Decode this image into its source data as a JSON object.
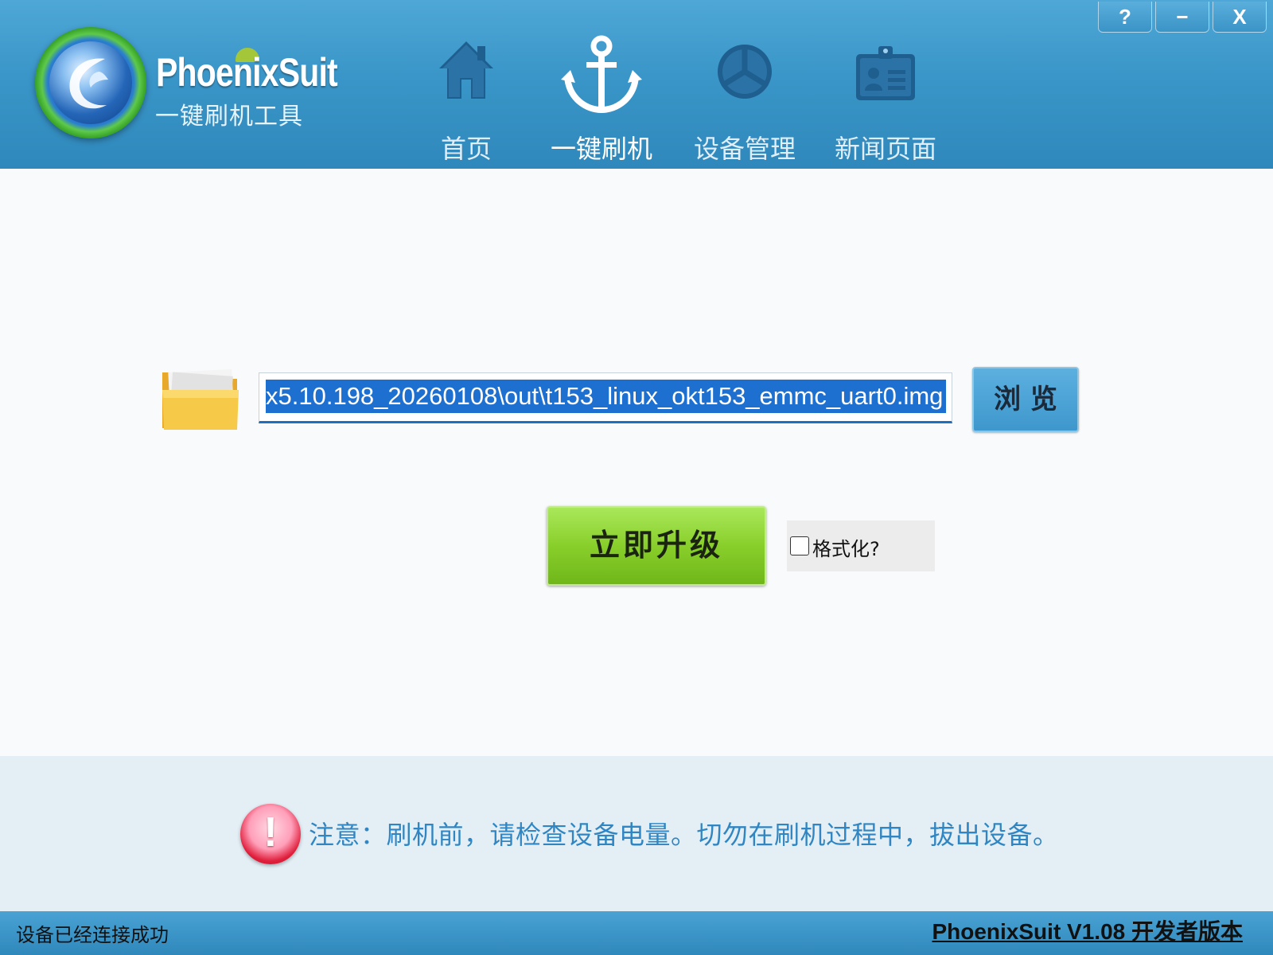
{
  "app": {
    "brand": "PhoenixSuit",
    "subtitle": "一键刷机工具"
  },
  "window_controls": {
    "help": "?",
    "minimize": "−",
    "close": "X"
  },
  "nav": {
    "items": [
      {
        "label": "首页",
        "icon": "home-icon"
      },
      {
        "label": "一键刷机",
        "icon": "anchor-icon",
        "active": true
      },
      {
        "label": "设备管理",
        "icon": "device-manage-icon"
      },
      {
        "label": "新闻页面",
        "icon": "news-icon"
      }
    ]
  },
  "main": {
    "image_path": "x5.10.198_20260108\\out\\t153_linux_okt153_emmc_uart0.img",
    "browse_label": "浏 览",
    "upgrade_label": "立即升级",
    "format_label": "格式化?",
    "format_checked": false
  },
  "notice": {
    "text": "注意：刷机前，请检查设备电量。切勿在刷机过程中，拔出设备。"
  },
  "status": {
    "left": "设备已经连接成功",
    "right": "PhoenixSuit V1.08 开发者版本"
  },
  "colors": {
    "header_blue": "#3a96c8",
    "upgrade_green": "#89cf2b",
    "notice_text": "#2f86c2",
    "selection_blue": "#1d6fd0"
  }
}
